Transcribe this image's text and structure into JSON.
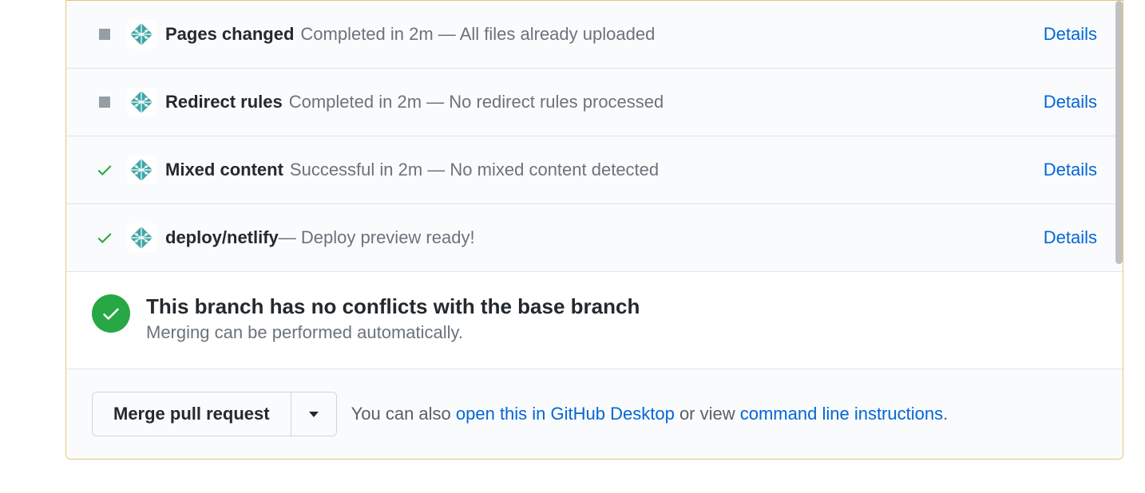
{
  "checks": [
    {
      "status": "neutral",
      "name": "Pages changed",
      "desc": "Completed in 2m — All files already uploaded",
      "details": "Details"
    },
    {
      "status": "neutral",
      "name": "Redirect rules",
      "desc": "Completed in 2m — No redirect rules processed",
      "details": "Details"
    },
    {
      "status": "success",
      "name": "Mixed content",
      "desc": "Successful in 2m — No mixed content detected",
      "details": "Details"
    },
    {
      "status": "success",
      "name": "deploy/netlify",
      "desc": " — Deploy preview ready!",
      "details": "Details",
      "inlineDash": true
    }
  ],
  "mergeStatus": {
    "title": "This branch has no conflicts with the base branch",
    "subtitle": "Merging can be performed automatically."
  },
  "mergeActions": {
    "buttonLabel": "Merge pull request",
    "hintPrefix": "You can also ",
    "desktopLink": "open this in GitHub Desktop",
    "hintMid": " or view ",
    "cliLink": "command line instructions",
    "hintSuffix": "."
  }
}
